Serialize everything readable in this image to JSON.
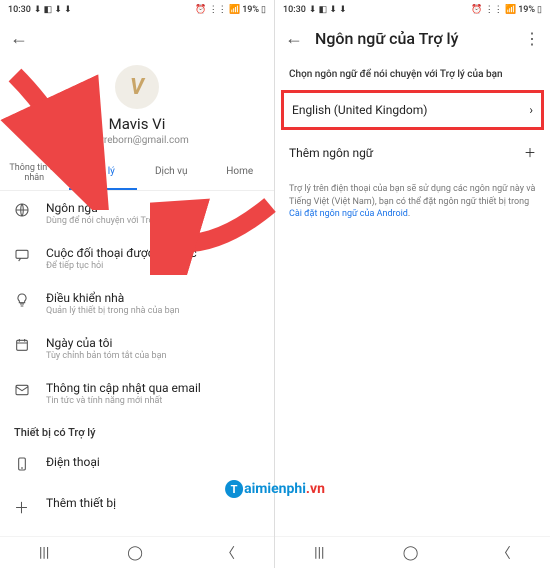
{
  "status": {
    "time": "10:30",
    "battery": "19%"
  },
  "left": {
    "profile": {
      "name": "Mavis Vi",
      "email": "htlwreborn@gmail.com",
      "avatar_letter": "V"
    },
    "tabs": {
      "t0": "Thông tin cá nhân",
      "t1": "Trợ lý",
      "t2": "Dịch vụ",
      "t3": "Home"
    },
    "items": {
      "lang": {
        "title": "Ngôn ngữ",
        "sub": "Dùng để nói chuyện với Trợ lý"
      },
      "conv": {
        "title": "Cuộc đối thoại được tiếp tục",
        "sub": "Để tiếp tục hỏi"
      },
      "home": {
        "title": "Điều khiển nhà",
        "sub": "Quản lý thiết bị trong nhà của bạn"
      },
      "day": {
        "title": "Ngày của tôi",
        "sub": "Tùy chỉnh bản tóm tắt của bạn"
      },
      "mail": {
        "title": "Thông tin cập nhật qua email",
        "sub": "Tin tức và tính năng mới nhất"
      }
    },
    "devices_head": "Thiết bị có Trợ lý",
    "devices": {
      "phone": "Điện thoại",
      "add": "Thêm thiết bị"
    }
  },
  "right": {
    "title": "Ngôn ngữ của Trợ lý",
    "prompt": "Chọn ngôn ngữ để nói chuyện với Trợ lý của bạn",
    "selected": "English (United Kingdom)",
    "add": "Thêm ngôn ngữ",
    "info_a": "Trợ lý trên điện thoại của bạn sẽ sử dụng các ngôn ngữ này và Tiếng Việt (Việt Nam), bạn có thể đặt ngôn ngữ thiết bị trong ",
    "info_link": "Cài đặt ngôn ngữ của Android",
    "info_b": "."
  },
  "watermark": {
    "brand": "aimienphi",
    "suffix": ".vn"
  }
}
